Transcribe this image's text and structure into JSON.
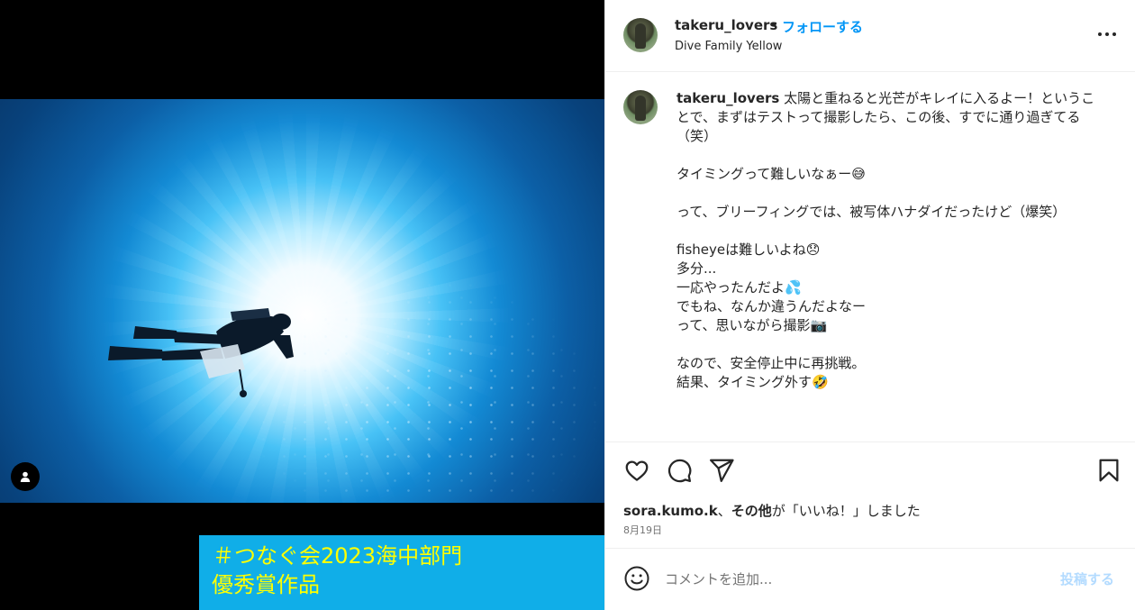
{
  "post": {
    "media_caption_lines": [
      "＃つなぐ会2023海中部門",
      "優秀賞作品"
    ],
    "caption_banner_color": "#10aee8",
    "caption_text_color": "#ffff00"
  },
  "header": {
    "username": "takeru_lovers",
    "separator": "•",
    "follow_label": "フォローする",
    "location": "Dive Family Yellow",
    "more_icon": "more-horizontal-icon"
  },
  "caption": {
    "username": "takeru_lovers",
    "text": " 太陽と重ねると光芒がキレイに入るよー！ということで、まずはテストって撮影したら、この後、すでに通り過ぎてる（笑）\n\nタイミングって難しいなぁー😅\n\nって、ブリーフィングでは、被写体ハナダイだったけど（爆笑）\n\nfisheyeは難しいよね😞\n多分...\n一応やったんだよ💦\nでもね、なんか違うんだよなー\nって、思いながら撮影📷\n\nなので、安全停止中に再挑戦。\n結果、タイミング外す🤣\n\n"
  },
  "actions": {
    "icons": [
      "heart-icon",
      "comment-icon",
      "share-icon",
      "bookmark-icon"
    ]
  },
  "likes": {
    "user": "sora.kumo.k",
    "separator": "、",
    "others": "その他",
    "suffix": "が「いいね！」しました"
  },
  "date": "8月19日",
  "composer": {
    "placeholder": "コメントを追加...",
    "post_label": "投稿する",
    "emoji_icon": "emoji-icon"
  },
  "colors": {
    "accent": "#0095f6",
    "post_disabled": "#b3dbff",
    "text": "#262626",
    "muted": "#737373"
  }
}
